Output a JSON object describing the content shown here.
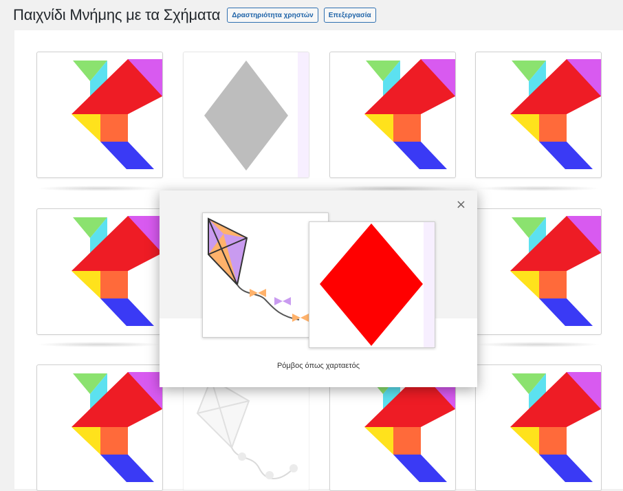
{
  "header": {
    "title": "Παιχνίδι Μνήμης με τα Σχήματα",
    "activity_button": "Δραστηριότητα χρηστών",
    "edit_button": "Επεξεργασία"
  },
  "cards": [
    {
      "id": "r1c1",
      "face": "tangram-bird"
    },
    {
      "id": "r1c2",
      "face": "grey-rhombus"
    },
    {
      "id": "r1c3",
      "face": "tangram-bird"
    },
    {
      "id": "r1c4",
      "face": "tangram-bird"
    },
    {
      "id": "r2c1",
      "face": "tangram-bird"
    },
    {
      "id": "r2c4",
      "face": "tangram-bird"
    },
    {
      "id": "r3c1",
      "face": "tangram-bird"
    },
    {
      "id": "r3c2",
      "face": "faded-kite"
    },
    {
      "id": "r3c3",
      "face": "tangram-bird"
    },
    {
      "id": "r3c4",
      "face": "tangram-bird"
    }
  ],
  "modal": {
    "close_symbol": "×",
    "caption": "Ρόμβος όπως χαρταετός",
    "left_image": "kite",
    "right_image": "red-rhombus"
  },
  "colors": {
    "red": "#ee1c25",
    "cyan": "#5ce1f0",
    "green": "#8be26f",
    "violet": "#d85af0",
    "yellow": "#ffe21c",
    "orange": "#ff6a3a",
    "blue": "#3a3af5",
    "rhombus_red": "#ff0000",
    "rhombus_grey": "#bdbdbd",
    "button_blue": "#1e63a8"
  }
}
